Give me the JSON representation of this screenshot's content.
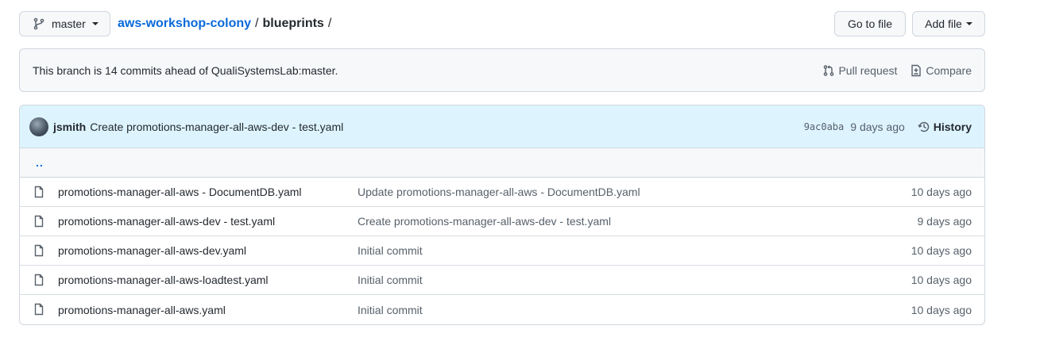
{
  "branch": {
    "name": "master"
  },
  "breadcrumb": {
    "repo": "aws-workshop-colony",
    "sep1": "/",
    "dir": "blueprints",
    "sep2": "/"
  },
  "actions": {
    "go_to_file": "Go to file",
    "add_file": "Add file"
  },
  "branch_status": {
    "message": "This branch is 14 commits ahead of QualiSystemsLab:master.",
    "pull_request": "Pull request",
    "compare": "Compare"
  },
  "latest_commit": {
    "author": "jsmith",
    "message": "Create promotions-manager-all-aws-dev - test.yaml",
    "sha": "9ac0aba",
    "age": "9 days ago",
    "history_label": "History"
  },
  "parent_dir": "..",
  "files": [
    {
      "name": "promotions-manager-all-aws - DocumentDB.yaml",
      "commit": "Update promotions-manager-all-aws - DocumentDB.yaml",
      "age": "10 days ago"
    },
    {
      "name": "promotions-manager-all-aws-dev - test.yaml",
      "commit": "Create promotions-manager-all-aws-dev - test.yaml",
      "age": "9 days ago"
    },
    {
      "name": "promotions-manager-all-aws-dev.yaml",
      "commit": "Initial commit",
      "age": "10 days ago"
    },
    {
      "name": "promotions-manager-all-aws-loadtest.yaml",
      "commit": "Initial commit",
      "age": "10 days ago"
    },
    {
      "name": "promotions-manager-all-aws.yaml",
      "commit": "Initial commit",
      "age": "10 days ago"
    }
  ],
  "colors": {
    "link": "#0969da",
    "muted": "#57606a",
    "border": "#d0d7de",
    "commit_bar": "#ddf4ff"
  }
}
